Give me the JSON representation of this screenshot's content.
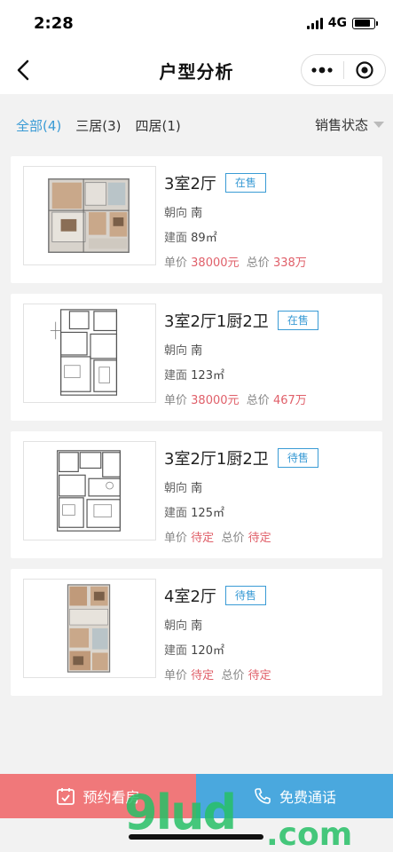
{
  "status": {
    "time": "2:28",
    "network": "4G"
  },
  "nav": {
    "title": "户型分析"
  },
  "filters": {
    "tabs": [
      "全部(4)",
      "三居(3)",
      "四居(1)"
    ],
    "sale_status_label": "销售状态"
  },
  "labels": {
    "orientation": "朝向",
    "area": "建面",
    "unit_price": "单价",
    "total_price": "总价",
    "area_unit": "㎡"
  },
  "units": [
    {
      "title": "3室2厅",
      "status": "在售",
      "orientation": "南",
      "area": "89",
      "unit_price": "38000元",
      "total_price": "338万"
    },
    {
      "title": "3室2厅1厨2卫",
      "status": "在售",
      "orientation": "南",
      "area": "123",
      "unit_price": "38000元",
      "total_price": "467万"
    },
    {
      "title": "3室2厅1厨2卫",
      "status": "待售",
      "orientation": "南",
      "area": "125",
      "unit_price": "待定",
      "total_price": "待定"
    },
    {
      "title": "4室2厅",
      "status": "待售",
      "orientation": "南",
      "area": "120",
      "unit_price": "待定",
      "total_price": "待定"
    }
  ],
  "bottom": {
    "book_label": "预约看房",
    "call_label": "免费通话"
  },
  "watermark": {
    "text1": "9lud",
    "text2": ".com"
  },
  "colors": {
    "accent": "#3a9bd5",
    "price": "#e0606a",
    "book_bg": "#f0787a",
    "call_bg": "#4aa8de"
  }
}
